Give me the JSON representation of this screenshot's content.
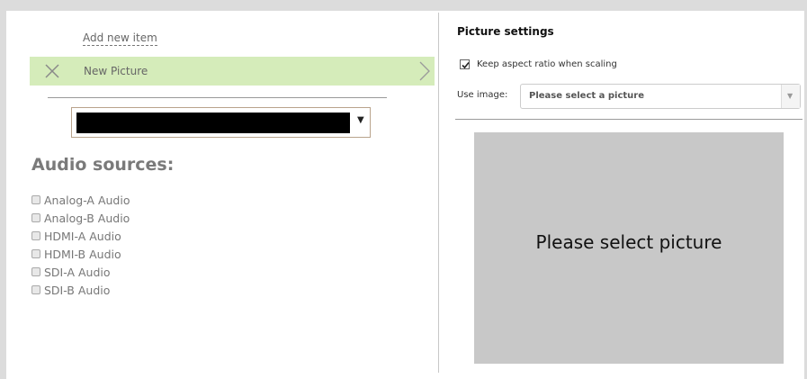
{
  "left_panel": {
    "add_new_item": "Add new item",
    "item": {
      "label": "New Picture"
    },
    "audio_title": "Audio sources:",
    "audio_sources": [
      {
        "label": "Analog-A Audio",
        "checked": false
      },
      {
        "label": "Analog-B Audio",
        "checked": false
      },
      {
        "label": "HDMI-A Audio",
        "checked": false
      },
      {
        "label": "HDMI-B Audio",
        "checked": false
      },
      {
        "label": "SDI-A Audio",
        "checked": false
      },
      {
        "label": "SDI-B Audio",
        "checked": false
      }
    ]
  },
  "right_panel": {
    "title": "Picture settings",
    "keep_aspect": {
      "label": "Keep aspect ratio when scaling",
      "checked": true
    },
    "use_image": {
      "label": "Use image:",
      "value": "Please select a picture"
    },
    "preview_text": "Please select picture"
  },
  "colors": {
    "selected_row": "#d5ecba",
    "preview_bg": "#c8c8c8"
  }
}
